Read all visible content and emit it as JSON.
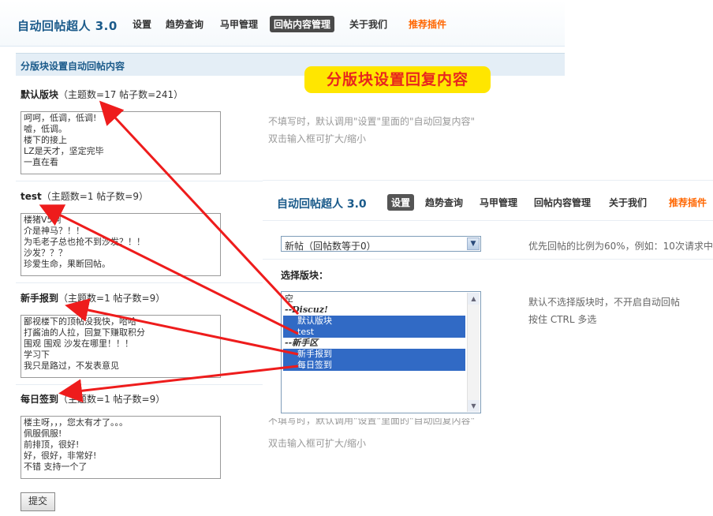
{
  "back": {
    "brand": "自动回帖超人 3.0",
    "nav": [
      "设置",
      "趋势查询",
      "马甲管理",
      "回帖内容管理",
      "关于我们",
      "推荐插件"
    ],
    "section_title": "分版块设置自动回帖内容",
    "banner": "分版块设置回复内容",
    "blocks": [
      {
        "name": "默认版块",
        "stats": "（主题数=17  帖子数=241）",
        "content": "呵呵，低调，低调!\n嘘，低调。\n楼下的接上\nLZ是天才，坚定完毕\n一直在看"
      },
      {
        "name": "test",
        "stats": "（主题数=1  帖子数=9）",
        "content": "楼猪V5啊\n介是神马？！！\n为毛老子总也抢不到沙发？！！\n沙发？？？\n珍爱生命，果断回帖。"
      },
      {
        "name": "新手报到",
        "stats": "（主题数=1  帖子数=9）",
        "content": "鄙视楼下的顶帖没我快，哈哈\n打酱油的人拉，回复下赚取积分\n围观 围观 沙发在哪里！！！\n学习下\n我只是路过，不发表意见"
      },
      {
        "name": "每日签到",
        "stats": "（主题数=1  帖子数=9）",
        "content": "楼主呀，，，您太有才了。。。\n佩服佩服!\n前排顶，很好!\n好，很好，非常好!\n不错 支持一个了"
      }
    ],
    "hint1": "不填写时，默认调用\"设置\"里面的\"自动回复内容\"",
    "hint2": "双击输入框可扩大/缩小",
    "hint3": "不填写时，默认调用\"设置\"里面的\"自动回复内容\"",
    "hint4": "双击输入框可扩大/缩小",
    "submit": "提交"
  },
  "front": {
    "brand": "自动回帖超人 3.0",
    "nav": [
      "设置",
      "趋势查询",
      "马甲管理",
      "回帖内容管理",
      "关于我们",
      "推荐插件"
    ],
    "select_value": "新帖（回帖数等于0）",
    "select_hint": "优先回帖的比例为60%，例如：10次请求中",
    "label": "选择版块：",
    "list_items": [
      {
        "text": "空",
        "type": "item",
        "selected": false
      },
      {
        "text": "--Discuz!",
        "type": "group",
        "selected": false
      },
      {
        "text": "默认版块",
        "type": "item",
        "selected": true
      },
      {
        "text": "test",
        "type": "item",
        "selected": true
      },
      {
        "text": "--新手区",
        "type": "group",
        "selected": false
      },
      {
        "text": "新手报到",
        "type": "item",
        "selected": true
      },
      {
        "text": "每日签到",
        "type": "item",
        "selected": true
      }
    ],
    "list_hint1": "默认不选择版块时，不开启自动回帖",
    "list_hint2": "按住 CTRL 多选"
  },
  "colors": {
    "accent": "#1a5a8a",
    "reco": "#ff6600",
    "arrow": "#ee1c1c",
    "banner_bg": "#ffe600",
    "banner_fg": "#e8251e",
    "selected": "#316ac5"
  }
}
